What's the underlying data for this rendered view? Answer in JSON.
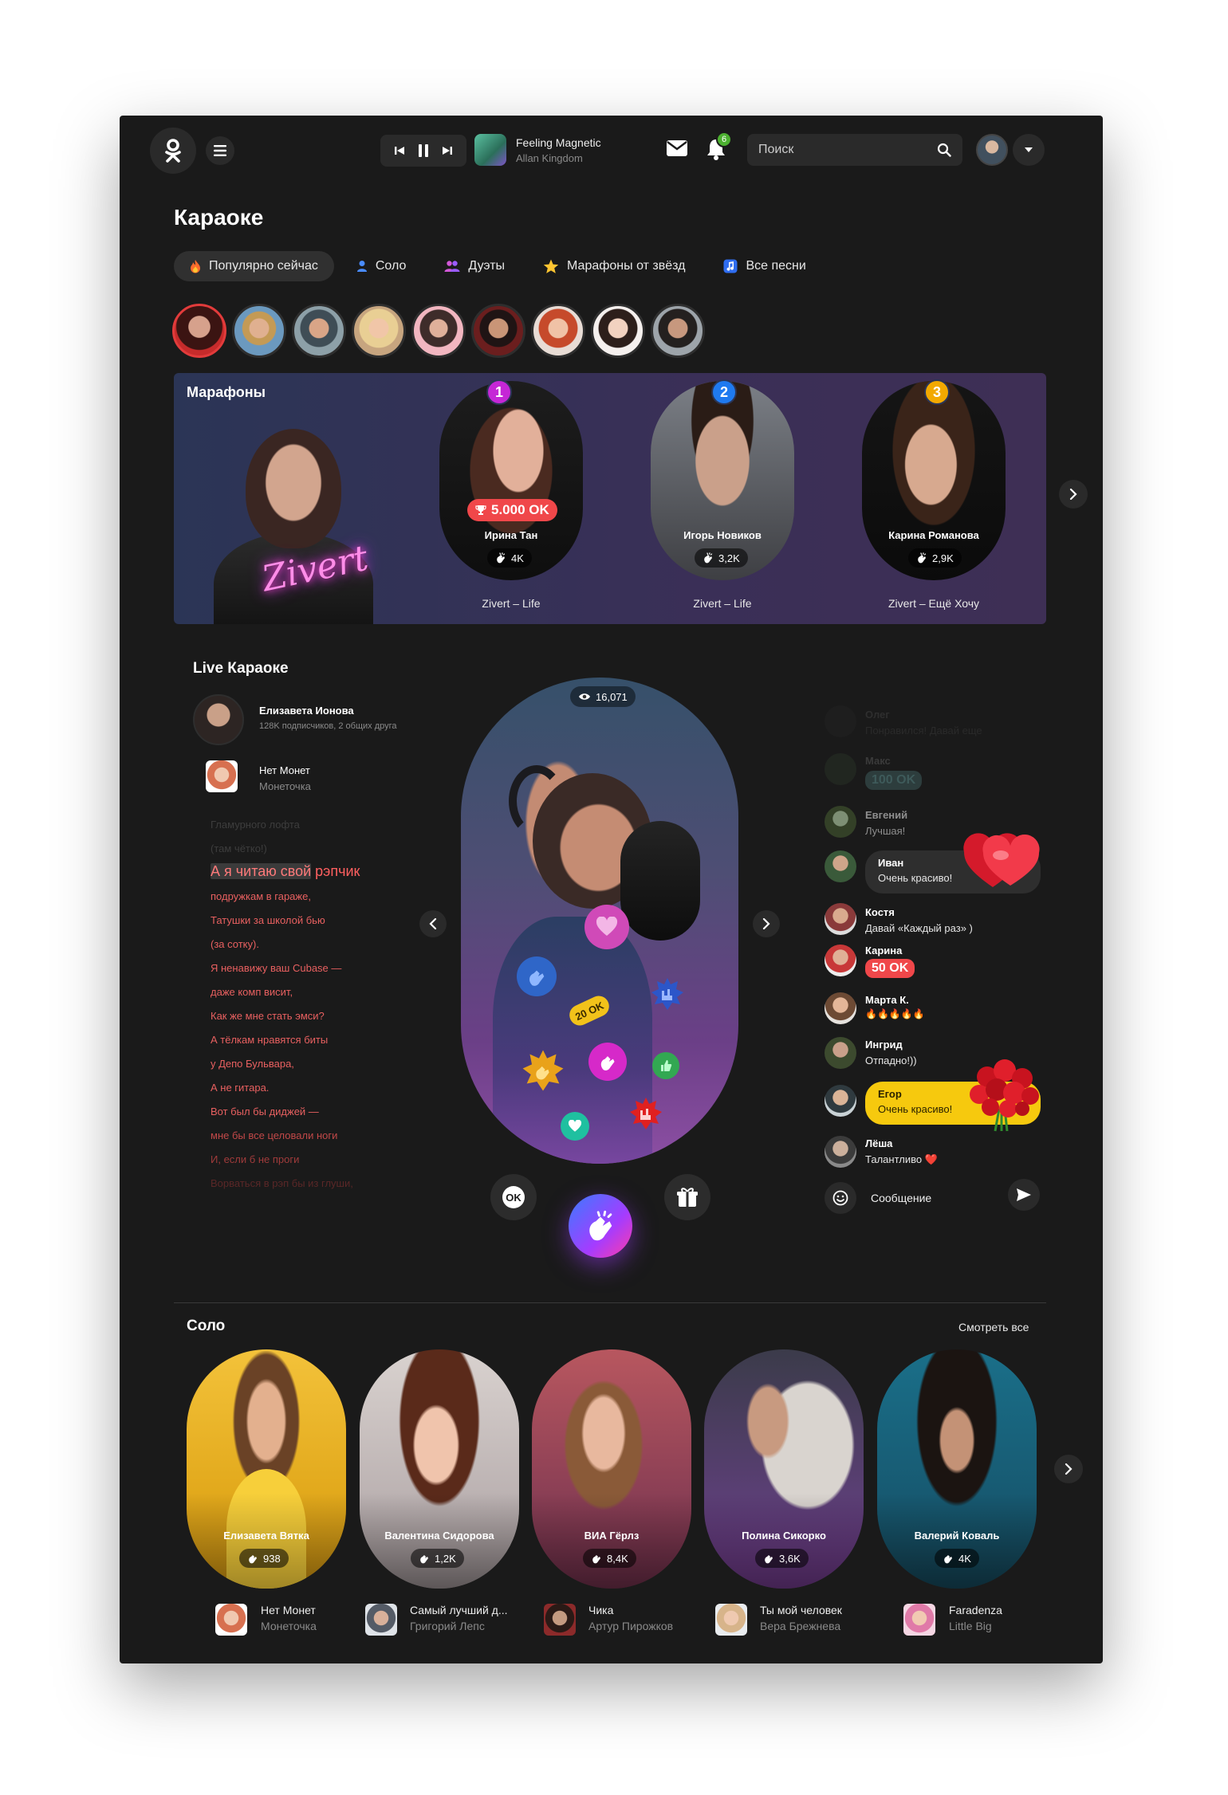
{
  "header": {
    "track_title": "Feeling Magnetic",
    "track_artist": "Allan Kingdom",
    "notifications_count": "6",
    "search_placeholder": "Поиск"
  },
  "page": {
    "title": "Караоке"
  },
  "tabs": [
    {
      "label": "Популярно сейчас",
      "icon": "fire-icon",
      "active": true
    },
    {
      "label": "Соло",
      "icon": "person-icon"
    },
    {
      "label": "Дуэты",
      "icon": "people-icon"
    },
    {
      "label": "Марафоны от звёзд",
      "icon": "star-icon"
    },
    {
      "label": "Все песни",
      "icon": "music-note-icon"
    }
  ],
  "marathons": {
    "title": "Марафоны",
    "featured_logo": "Zivert",
    "cards": [
      {
        "rank": "1",
        "name": "Ирина Тан",
        "count": "4K",
        "song": "Zivert – Life",
        "prize": "5.000 OK"
      },
      {
        "rank": "2",
        "name": "Игорь Новиков",
        "count": "3,2K",
        "song": "Zivert – Life"
      },
      {
        "rank": "3",
        "name": "Карина Романова",
        "count": "2,9K",
        "song": "Zivert – Ещё Хочу"
      }
    ]
  },
  "live": {
    "title": "Live Караоке",
    "user_name": "Елизавета Ионова",
    "user_sub": "128K подписчиков, 2 общих друга",
    "song_title": "Нет Монет",
    "song_artist": "Монеточка",
    "viewers": "16,071",
    "sticker_ok": "20 OK",
    "lyrics_before": [
      "Гламурного лофта",
      "(там чётко!)"
    ],
    "current_line_done": "А я читаю свой",
    "current_line_rest": " рэпчик",
    "lyrics_after": [
      "подружкам в гараже,",
      "Татушки за школой бью",
      "(за сотку).",
      "Я ненавижу ваш Cubase —",
      "даже комп висит,",
      "Как же мне стать эмси?",
      "А тёлкам нравятся биты",
      "у Депо Бульвара,",
      "А не гитара.",
      "Вот был бы диджей —",
      "мне бы все целовали ноги",
      "И, если б не проги"
    ],
    "lyrics_faded_last": "Ворваться в рэп бы из глуши,"
  },
  "chat": {
    "messages": [
      {
        "name": "Олег",
        "text": "Понравился! Давай еще"
      },
      {
        "name": "Макс",
        "ok": "100 OK"
      },
      {
        "name": "Евгений",
        "text": "Лучшая!"
      },
      {
        "name": "Иван",
        "text": "Очень красиво!"
      },
      {
        "name": "Костя",
        "text": "Давай «Каждый раз» )"
      },
      {
        "name": "Карина",
        "ok": "50 OK"
      },
      {
        "name": "Марта К.",
        "text": "🔥🔥🔥🔥🔥"
      },
      {
        "name": "Ингрид",
        "text": "Отпадно!))"
      },
      {
        "name": "Егор",
        "text": "Очень красиво!"
      },
      {
        "name": "Лёша",
        "text": "Талантливо ❤️"
      }
    ],
    "input_placeholder": "Сообщение"
  },
  "solo": {
    "title": "Соло",
    "see_all": "Смотреть все",
    "cards": [
      {
        "name": "Елизавета Вятка",
        "count": "938",
        "song": "Нет Монет",
        "artist": "Монеточка"
      },
      {
        "name": "Валентина Сидорова",
        "count": "1,2K",
        "song": "Самый лучший д...",
        "artist": "Григорий Лепс"
      },
      {
        "name": "ВИА Гёрлз",
        "count": "8,4K",
        "song": "Чика",
        "artist": "Артур Пирожков"
      },
      {
        "name": "Полина Сикорко",
        "count": "3,6K",
        "song": "Ты мой человек",
        "artist": "Вера Брежнева"
      },
      {
        "name": "Валерий Коваль",
        "count": "4K",
        "song": "Faradenza",
        "artist": "Little Big"
      }
    ]
  }
}
